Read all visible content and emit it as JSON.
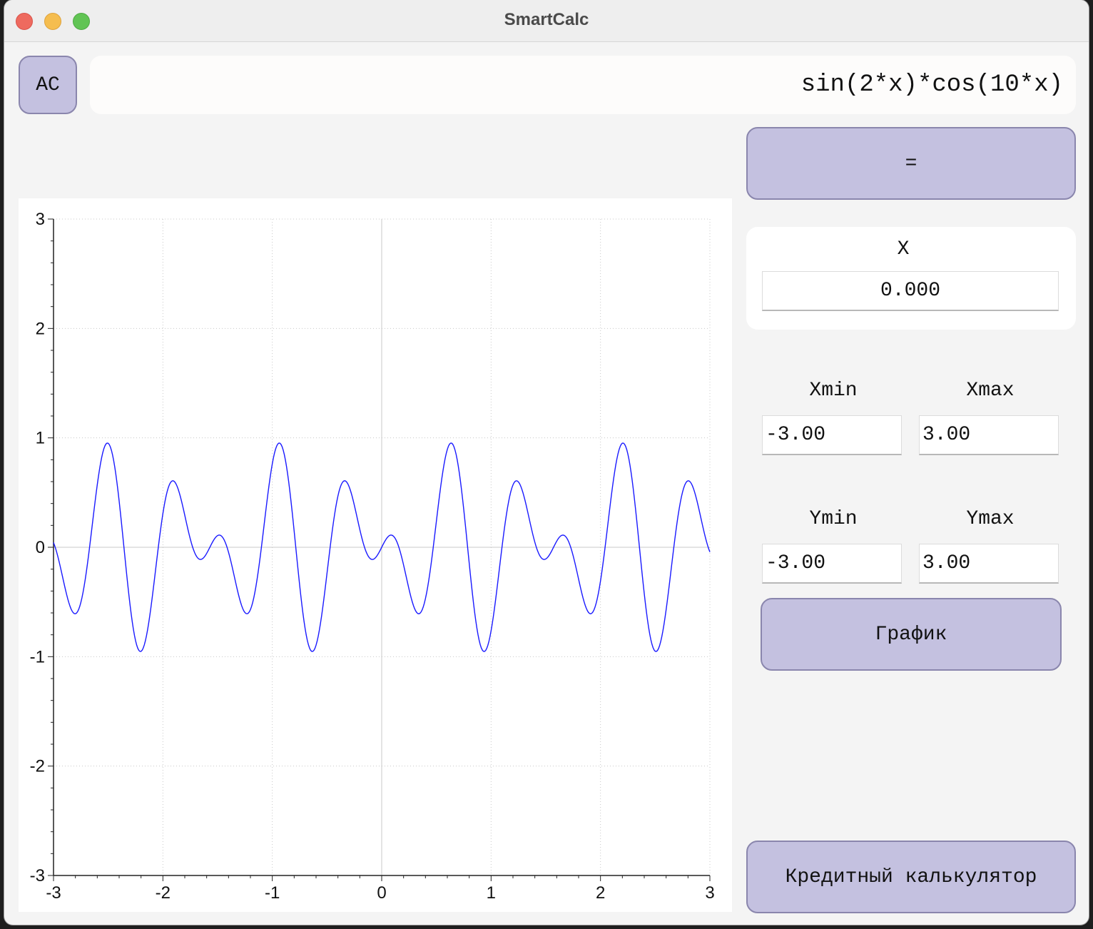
{
  "window": {
    "title": "SmartCalc"
  },
  "toolbar": {
    "ac_label": "AC"
  },
  "expression": {
    "value": "sin(2*x)*cos(10*x)"
  },
  "equals_label": "=",
  "x_panel": {
    "label": "X",
    "value": "0.000"
  },
  "range": {
    "xmin_label": "Xmin",
    "xmax_label": "Xmax",
    "xmin_value": "-3.00",
    "xmax_value": "3.00",
    "ymin_label": "Ymin",
    "ymax_label": "Ymax",
    "ymin_value": "-3.00",
    "ymax_value": "3.00"
  },
  "plot_button_label": "График",
  "credit_button_label": "Кредитный калькулятор",
  "colors": {
    "accent_button": "#c4c1e0",
    "curve": "#1a1aff"
  },
  "chart_data": {
    "type": "line",
    "title": "",
    "xlabel": "",
    "ylabel": "",
    "xlim": [
      -3,
      3
    ],
    "ylim": [
      -3,
      3
    ],
    "x_ticks": [
      -3,
      -2,
      -1,
      0,
      1,
      2,
      3
    ],
    "y_ticks": [
      -3,
      -2,
      -1,
      0,
      1,
      2,
      3
    ],
    "x_tick_labels": [
      "-3",
      "-2",
      "-1",
      "0",
      "1",
      "2",
      "3"
    ],
    "y_tick_labels": [
      "-3",
      "-2",
      "-1",
      "0",
      "1",
      "2",
      "3"
    ],
    "grid": true,
    "series": [
      {
        "function": "sin(2*x)*cos(10*x)",
        "color": "#1a1aff",
        "x_start": -3,
        "x_end": 3,
        "samples": 601
      }
    ]
  }
}
